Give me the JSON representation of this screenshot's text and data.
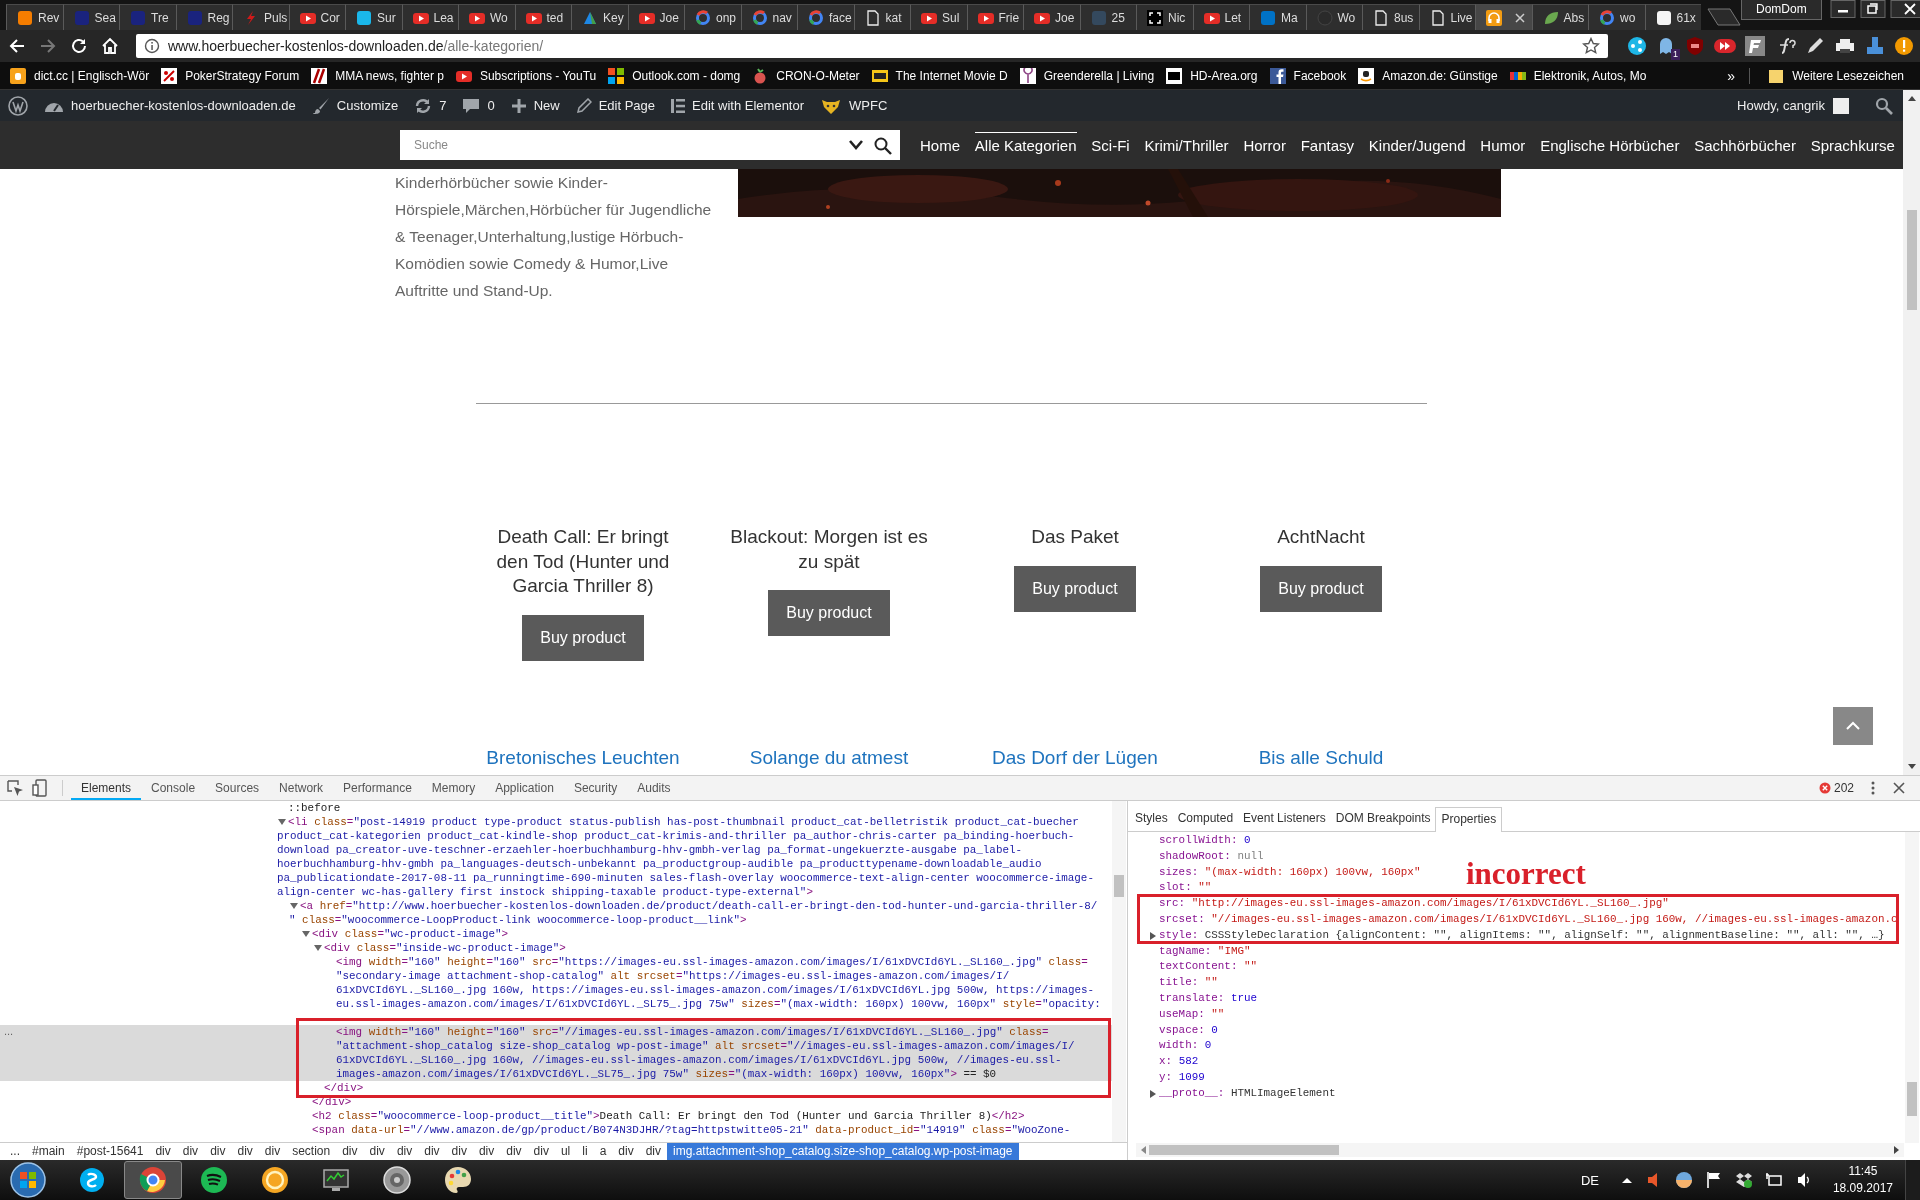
{
  "browser": {
    "tabs": [
      {
        "label": "Rev",
        "selected": false
      },
      {
        "label": "Sea",
        "selected": false
      },
      {
        "label": "Tre",
        "selected": false
      },
      {
        "label": "Reg",
        "selected": false
      },
      {
        "label": "Puls",
        "selected": false
      },
      {
        "label": "Cor",
        "selected": false
      },
      {
        "label": "Sur",
        "selected": false
      },
      {
        "label": "Lea",
        "selected": false
      },
      {
        "label": "Wo",
        "selected": false
      },
      {
        "label": "ted",
        "selected": false
      },
      {
        "label": "Key",
        "selected": false
      },
      {
        "label": "Joe",
        "selected": false
      },
      {
        "label": "onp",
        "selected": false
      },
      {
        "label": "nav",
        "selected": false
      },
      {
        "label": "face",
        "selected": false
      },
      {
        "label": "kat",
        "selected": false
      },
      {
        "label": "Sul",
        "selected": false
      },
      {
        "label": "Frie",
        "selected": false
      },
      {
        "label": "Joe",
        "selected": false
      },
      {
        "label": "25",
        "selected": false
      },
      {
        "label": "Nic",
        "selected": false
      },
      {
        "label": "Let",
        "selected": false
      },
      {
        "label": "Ma",
        "selected": false
      },
      {
        "label": "Wo",
        "selected": false
      },
      {
        "label": "8us",
        "selected": false
      },
      {
        "label": "Live",
        "selected": false
      },
      {
        "selected": true
      },
      {
        "label": "Abs",
        "selected": false
      },
      {
        "label": "wo",
        "selected": false
      },
      {
        "label": "61x",
        "selected": false
      }
    ],
    "profile": "DomDom",
    "address_bar": {
      "host": "www.hoerbuecher-kostenlos-downloaden.de",
      "path": "/alle-kategorien/"
    },
    "extension_badge": "1",
    "bookmarks": [
      "dict.cc | Englisch-Wör",
      "PokerStrategy Forum",
      "MMA news, fighter p",
      "Subscriptions - YouTu",
      "Outlook.com - domg",
      "CRON-O-Meter",
      "The Internet Movie D",
      "Greenderella | Living",
      "HD-Area.org",
      "Facebook",
      "Amazon.de: Günstige",
      "Elektronik, Autos, Mo"
    ],
    "bookmarks_overflow": "»",
    "other_bookmarks": "Weitere Lesezeichen"
  },
  "wp_admin_bar": {
    "site": "hoerbuecher-kostenlos-downloaden.de",
    "customize": "Customize",
    "updates": "7",
    "comments": "0",
    "new": "New",
    "edit_page": "Edit Page",
    "elementor": "Edit with Elementor",
    "wpfc": "WPFC",
    "greeting": "Howdy, cangrik"
  },
  "site_header": {
    "search": {
      "placeholder": "Suche"
    },
    "nav": [
      {
        "label": "Home",
        "selected": false
      },
      {
        "label": "Alle Kategorien",
        "selected": true
      },
      {
        "label": "Sci-Fi",
        "selected": false
      },
      {
        "label": "Krimi/Thriller",
        "selected": false
      },
      {
        "label": "Horror",
        "selected": false
      },
      {
        "label": "Fantasy",
        "selected": false
      },
      {
        "label": "Kinder/Jugend",
        "selected": false
      },
      {
        "label": "Humor",
        "selected": false
      },
      {
        "label": "Englische Hörbücher",
        "selected": false
      },
      {
        "label": "Sachhörbücher",
        "selected": false
      },
      {
        "label": "Sprachkurse",
        "selected": false
      }
    ]
  },
  "content": {
    "intro": "Kinderhörbücher sowie Kinder-Hörspiele,Märchen,Hörbücher für Jugendliche & Teenager,Unterhaltung,lustige Hörbuch-Komödien sowie Comedy & Humor,Live Auftritte und Stand-Up.",
    "products": [
      {
        "title": "Death Call: Er bringt den Tod (Hunter und Garcia Thriller 8)",
        "button": "Buy product"
      },
      {
        "title": "Blackout: Morgen ist es zu spät",
        "button": "Buy product"
      },
      {
        "title": "Das Paket",
        "button": "Buy product"
      },
      {
        "title": "AchtNacht",
        "button": "Buy product"
      }
    ],
    "next_products": [
      "Bretonisches Leuchten",
      "Solange du atmest",
      "Das Dorf der Lügen",
      "Bis alle Schuld"
    ]
  },
  "devtools": {
    "tabs": [
      {
        "label": "Elements",
        "selected": true
      },
      {
        "label": "Console",
        "selected": false
      },
      {
        "label": "Sources",
        "selected": false
      },
      {
        "label": "Network",
        "selected": false
      },
      {
        "label": "Performance",
        "selected": false
      },
      {
        "label": "Memory",
        "selected": false
      },
      {
        "label": "Application",
        "selected": false
      },
      {
        "label": "Security",
        "selected": false
      },
      {
        "label": "Audits",
        "selected": false
      }
    ],
    "error_count": "202",
    "dom_tree": [
      {
        "lines": [
          "::before"
        ],
        "selected": false
      },
      {
        "lines": [
          "<li class=\"post-14919 product type-product status-publish has-post-thumbnail product_cat-belletristik product_cat-buecher",
          "product_cat-kategorien product_cat-kindle-shop product_cat-krimis-and-thriller pa_author-chris-carter pa_binding-hoerbuch-",
          "download pa_creator-uve-teschner-erzaehler-hoerbuchhamburg-hhv-gmbh-verlag pa_format-ungekuerzte-ausgabe pa_label-",
          "hoerbuchhamburg-hhv-gmbh pa_languages-deutsch-unbekannt pa_productgroup-audible pa_producttypename-downloadable_audio",
          "pa_publicationdate-2017-08-11 pa_runningtime-690-minuten sales-flash-overlay woocommerce-text-align-center woocommerce-image-",
          "align-center wc-has-gallery first instock shipping-taxable product-type-external\">"
        ],
        "selected": false,
        "expanded": true,
        "children": [
          {
            "lines": [
              "<a href=\"http://www.hoerbuecher-kostenlos-downloaden.de/product/death-call-er-bringt-den-tod-hunter-und-garcia-thriller-8/",
              "\" class=\"woocommerce-LoopProduct-link woocommerce-loop-product__link\">"
            ],
            "selected": false,
            "expanded": true,
            "children": [
              {
                "lines": [
                  "<div class=\"wc-product-image\">"
                ],
                "selected": false,
                "expanded": true,
                "closing": "</div>",
                "children": [
                  {
                    "lines": [
                      "<div class=\"inside-wc-product-image\">"
                    ],
                    "selected": false,
                    "expanded": true,
                    "closing": "</div>",
                    "children": [
                      {
                        "lines": [
                          "<img width=\"160\" height=\"160\" src=\"https://images-eu.ssl-images-amazon.com/images/I/61xDVCId6YL._SL160_.jpg\" class=",
                          "\"secondary-image attachment-shop-catalog\" alt srcset=\"https://images-eu.ssl-images-amazon.com/images/I/",
                          "61xDVCId6YL._SL160_.jpg 160w, https://images-eu.ssl-images-amazon.com/images/I/61xDVCId6YL.jpg 500w, https://images-",
                          "eu.ssl-images-amazon.com/images/I/61xDVCId6YL._SL75_.jpg 75w\" sizes=\"(max-width: 160px) 100vw, 160px\" style=\"opacity:"
                        ],
                        "selected": false
                      },
                      {
                        "lines": [
                          "<img width=\"160\" height=\"160\" src=\"//images-eu.ssl-images-amazon.com/images/I/61xDVCId6YL._SL160_.jpg\" class=",
                          "\"attachment-shop_catalog size-shop_catalog wp-post-image\" alt srcset=\"//images-eu.ssl-images-amazon.com/images/I/",
                          "61xDVCId6YL._SL160_.jpg 160w, //images-eu.ssl-images-amazon.com/images/I/61xDVCId6YL.jpg 500w, //images-eu.ssl-",
                          "images-amazon.com/images/I/61xDVCId6YL._SL75_.jpg 75w\" sizes=\"(max-width: 160px) 100vw, 160px\"> == $0"
                        ],
                        "selected": true,
                        "marker": "..."
                      }
                    ]
                  }
                ]
              },
              {
                "lines": [
                  "<h2 class=\"woocommerce-loop-product__title\">Death Call: Er bringt den Tod (Hunter und Garcia Thriller 8)</h2>"
                ],
                "selected": false
              },
              {
                "lines": [
                  "<span data-url=\"//www.amazon.de/gp/product/B074N3DJHR/?tag=httpstwitte05-21\" data-product_id=\"14919\" class=\"WooZone-"
                ],
                "selected": false
              }
            ]
          }
        ]
      }
    ],
    "breadcrumbs": [
      {
        "label": "...",
        "selected": false
      },
      {
        "label": "#main",
        "selected": false
      },
      {
        "label": "#post-15641",
        "selected": false
      },
      {
        "label": "div",
        "selected": false
      },
      {
        "label": "div",
        "selected": false
      },
      {
        "label": "div",
        "selected": false
      },
      {
        "label": "div",
        "selected": false
      },
      {
        "label": "div",
        "selected": false
      },
      {
        "label": "section",
        "selected": false
      },
      {
        "label": "div",
        "selected": false
      },
      {
        "label": "div",
        "selected": false
      },
      {
        "label": "div",
        "selected": false
      },
      {
        "label": "div",
        "selected": false
      },
      {
        "label": "div",
        "selected": false
      },
      {
        "label": "div",
        "selected": false
      },
      {
        "label": "div",
        "selected": false
      },
      {
        "label": "div",
        "selected": false
      },
      {
        "label": "ul",
        "selected": false
      },
      {
        "label": "li",
        "selected": false
      },
      {
        "label": "a",
        "selected": false
      },
      {
        "label": "div",
        "selected": false
      },
      {
        "label": "div",
        "selected": false
      },
      {
        "label": "img.attachment-shop_catalog.size-shop_catalog.wp-post-image",
        "selected": true
      }
    ],
    "sidebar_tabs": [
      {
        "label": "Styles",
        "selected": false
      },
      {
        "label": "Computed",
        "selected": false
      },
      {
        "label": "Event Listeners",
        "selected": false
      },
      {
        "label": "DOM Breakpoints",
        "selected": false
      },
      {
        "label": "Properties",
        "selected": true
      }
    ],
    "properties": [
      {
        "key": "scrollWidth:",
        "value": "0",
        "kind": "number"
      },
      {
        "key": "shadowRoot:",
        "value": "null",
        "kind": "null"
      },
      {
        "key": "sizes:",
        "value": "\"(max-width: 160px) 100vw, 160px\"",
        "kind": "string"
      },
      {
        "key": "slot:",
        "value": "\"\"",
        "kind": "string"
      },
      {
        "key": "src:",
        "value": "\"http://images-eu.ssl-images-amazon.com/images/I/61xDVCId6YL._SL160_.jpg\"",
        "kind": "string"
      },
      {
        "key": "srcset:",
        "value": "\"//images-eu.ssl-images-amazon.com/images/I/61xDVCId6YL._SL160_.jpg 160w, //images-eu.ssl-images-amazon.c",
        "kind": "string"
      },
      {
        "key": "style:",
        "value": "CSSStyleDeclaration {alignContent: \"\", alignItems: \"\", alignSelf: \"\", alignmentBaseline: \"\", all: \"\", …}",
        "kind": "object",
        "expanded": false
      },
      {
        "key": "tagName:",
        "value": "\"IMG\"",
        "kind": "string"
      },
      {
        "key": "textContent:",
        "value": "\"\"",
        "kind": "string"
      },
      {
        "key": "title:",
        "value": "\"\"",
        "kind": "string"
      },
      {
        "key": "translate:",
        "value": "true",
        "kind": "boolean"
      },
      {
        "key": "useMap:",
        "value": "\"\"",
        "kind": "string"
      },
      {
        "key": "vspace:",
        "value": "0",
        "kind": "number"
      },
      {
        "key": "width:",
        "value": "0",
        "kind": "number"
      },
      {
        "key": "x:",
        "value": "582",
        "kind": "number"
      },
      {
        "key": "y:",
        "value": "1099",
        "kind": "number"
      },
      {
        "key": "__proto__:",
        "value": "HTMLImageElement",
        "kind": "object",
        "expanded": false
      }
    ],
    "annotation": "incorrect"
  },
  "taskbar": {
    "apps": [
      {
        "selected": false
      },
      {
        "selected": true
      },
      {
        "selected": false
      },
      {
        "selected": false
      },
      {
        "selected": false
      },
      {
        "selected": false
      },
      {
        "selected": false
      }
    ],
    "language": "DE",
    "time": "11:45",
    "date": "18.09.2017"
  }
}
